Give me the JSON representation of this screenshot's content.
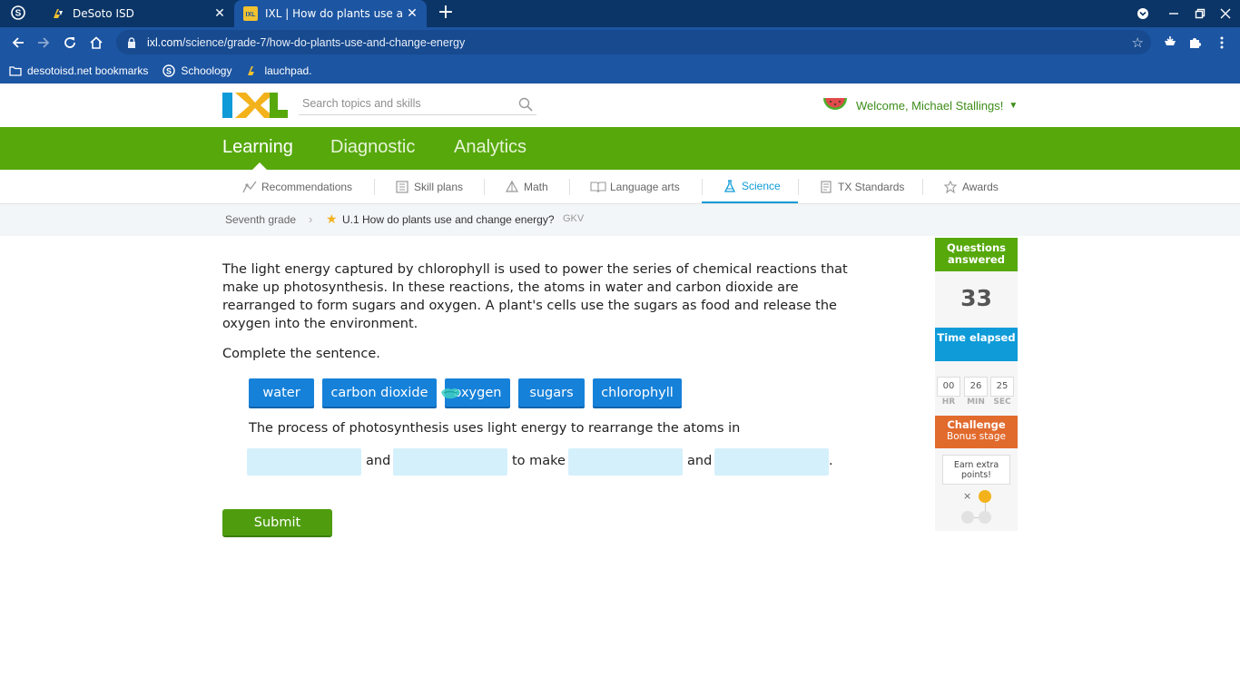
{
  "browser": {
    "tabs": [
      {
        "title": "",
        "icon": "schoology-icon"
      },
      {
        "title": "DeSoto ISD",
        "icon": "desoto-icon"
      },
      {
        "title": "IXL | How do plants use and cha",
        "icon": "ixl-icon"
      }
    ],
    "url_host": "ixl.com",
    "url_path": "/science/grade-7/how-do-plants-use-and-change-energy",
    "bookmarks": [
      {
        "label": "desotoisd.net bookmarks",
        "icon": "folder-icon"
      },
      {
        "label": "Schoology",
        "icon": "schoology-icon"
      },
      {
        "label": "lauchpad.",
        "icon": "launchpad-icon"
      }
    ]
  },
  "header": {
    "search_placeholder": "Search topics and skills",
    "welcome": "Welcome, Michael Stallings!"
  },
  "main_nav": {
    "items": [
      "Learning",
      "Diagnostic",
      "Analytics"
    ],
    "active": "Learning"
  },
  "sub_nav": {
    "items": [
      {
        "label": "Recommendations",
        "icon": "recommendations-icon"
      },
      {
        "label": "Skill plans",
        "icon": "skill-plans-icon"
      },
      {
        "label": "Math",
        "icon": "math-icon"
      },
      {
        "label": "Language arts",
        "icon": "language-arts-icon"
      },
      {
        "label": "Science",
        "icon": "science-icon"
      },
      {
        "label": "TX Standards",
        "icon": "standards-icon"
      },
      {
        "label": "Awards",
        "icon": "awards-icon"
      }
    ],
    "active": "Science"
  },
  "breadcrumb": {
    "grade": "Seventh grade",
    "skill": "U.1 How do plants use and change energy?",
    "code": "GKV"
  },
  "question": {
    "passage": "The light energy captured by chlorophyll is used to power the series of chemical reactions that make up photosynthesis. In these reactions, the atoms in water and carbon dioxide are rearranged to form sugars and oxygen. A plant's cells use the sugars as food and release the oxygen into the environment.",
    "instruction": "Complete the sentence.",
    "tiles": [
      "water",
      "carbon dioxide",
      "oxygen",
      "sugars",
      "chlorophyll"
    ],
    "sentence": "The process of photosynthesis uses light energy to rearrange the atoms in",
    "joiners": [
      "and",
      "to make",
      "and",
      "."
    ],
    "submit": "Submit"
  },
  "sidebar": {
    "questions_answered_label": "Questions answered",
    "questions_answered": "33",
    "time_label": "Time elapsed",
    "time": {
      "hr": "00",
      "min": "26",
      "sec": "25"
    },
    "time_units": {
      "hr": "HR",
      "min": "MIN",
      "sec": "SEC"
    },
    "challenge_title": "Challenge",
    "challenge_sub": "Bonus stage",
    "extra": "Earn extra points!",
    "x_mark": "×"
  },
  "colors": {
    "ixl_green": "#56a80b",
    "ixl_blue": "#0e9bd8",
    "tile_blue": "#1681d9",
    "challenge_orange": "#e16a2d",
    "chrome_blue": "#1c55a2"
  }
}
